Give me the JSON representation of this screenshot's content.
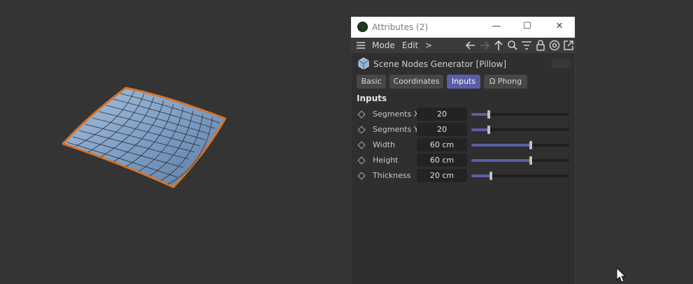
{
  "window": {
    "title": "Attributes (2)",
    "minimize_glyph": "—",
    "maximize_glyph": "☐",
    "close_glyph": "✕"
  },
  "menubar": {
    "menu_icon": "hamburger-icon",
    "items": [
      "Mode",
      "Edit",
      ">"
    ],
    "toolbar_icons": [
      "arrow-left-icon",
      "arrow-right-icon",
      "arrow-up-icon",
      "search-icon",
      "filter-icon",
      "lock-icon",
      "target-icon",
      "external-link-icon"
    ]
  },
  "object": {
    "icon": "scene-nodes-cube-icon",
    "name": "Scene Nodes Generator [Pillow]"
  },
  "tabs": [
    {
      "label": "Basic",
      "active": false
    },
    {
      "label": "Coordinates",
      "active": false
    },
    {
      "label": "Inputs",
      "active": true
    },
    {
      "label": "Ω Phong",
      "active": false
    }
  ],
  "section": {
    "title": "Inputs"
  },
  "params": [
    {
      "label": "Segments X",
      "value": "20",
      "slider": 0.18
    },
    {
      "label": "Segments Y",
      "value": "20",
      "slider": 0.18
    },
    {
      "label": "Width",
      "value": "60 cm",
      "slider": 0.61
    },
    {
      "label": "Height",
      "value": "60 cm",
      "slider": 0.61
    },
    {
      "label": "Thickness",
      "value": "20 cm",
      "slider": 0.2
    }
  ],
  "colors": {
    "accent": "#5b5ea6",
    "pillow_fill": "#7f9fc6",
    "selection_outline": "#d8742a",
    "viewport_bg": "#343434"
  }
}
